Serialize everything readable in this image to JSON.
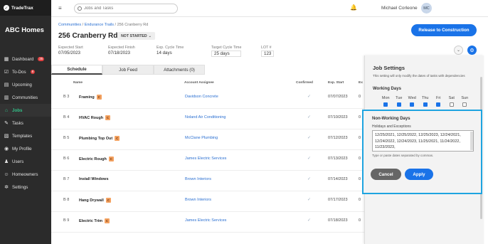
{
  "app": {
    "name": "TradeTrax",
    "company": "ABC Homes"
  },
  "sidebar": {
    "items": [
      {
        "label": "Dashboard",
        "icon": "dashboard-icon",
        "glyph": "▦",
        "badge": "35"
      },
      {
        "label": "To-Dos",
        "icon": "todo-icon",
        "glyph": "☑",
        "badge": "8"
      },
      {
        "label": "Upcoming",
        "icon": "calendar-icon",
        "glyph": "▤",
        "badge": ""
      },
      {
        "label": "Communities",
        "icon": "community-icon",
        "glyph": "▥",
        "badge": ""
      },
      {
        "label": "Jobs",
        "icon": "home-icon",
        "glyph": "⌂",
        "badge": ""
      },
      {
        "label": "Tasks",
        "icon": "wrench-icon",
        "glyph": "✎",
        "badge": ""
      },
      {
        "label": "Templates",
        "icon": "template-icon",
        "glyph": "▧",
        "badge": ""
      },
      {
        "label": "My Profile",
        "icon": "profile-icon",
        "glyph": "◉",
        "badge": ""
      },
      {
        "label": "Users",
        "icon": "users-icon",
        "glyph": "♟",
        "badge": ""
      },
      {
        "label": "Homeowners",
        "icon": "homeowners-icon",
        "glyph": "☺",
        "badge": ""
      },
      {
        "label": "Settings",
        "icon": "settings-icon",
        "glyph": "✲",
        "badge": ""
      }
    ]
  },
  "topbar": {
    "search_placeholder": "Jobs and Tasks",
    "user_name": "Michael Corleone",
    "user_initials": "MC"
  },
  "breadcrumb": {
    "a": "Communities",
    "b": "Endurance Trails",
    "current": "256 Cranberry Rd"
  },
  "job": {
    "title": "256 Cranberry Rd",
    "status": "NOT STARTED",
    "release_label": "Release to Construction",
    "meta": [
      {
        "label": "Expected Start",
        "value": "07/05/2023"
      },
      {
        "label": "Expected Finish",
        "value": "07/18/2023"
      },
      {
        "label": "Exp. Cycle Time",
        "value": "14 days"
      },
      {
        "label": "Target Cycle Time",
        "value": "25 days"
      },
      {
        "label": "LOT #",
        "value": "123"
      }
    ]
  },
  "tabs": [
    "Schedule",
    "Job Feed",
    "Attachments (0)"
  ],
  "table": {
    "headers": {
      "name": "Name",
      "assignee": "Account Assignee",
      "confirmed": "Confirmed",
      "start": "Exp. Start",
      "extra": "Ex"
    },
    "rows": [
      {
        "num": "B 3",
        "name": "Framing",
        "badge": "C",
        "assignee": "Davidson Concrete",
        "start": "07/07/2023",
        "extra": "0"
      },
      {
        "num": "B 4",
        "name": "HVAC Rough",
        "badge": "C",
        "assignee": "Noland Air Conditioning",
        "start": "07/10/2023",
        "extra": "0"
      },
      {
        "num": "B 5",
        "name": "Plumbing Top Out",
        "badge": "C",
        "assignee": "McClane Plumbing",
        "start": "07/12/2023",
        "extra": "0"
      },
      {
        "num": "B 6",
        "name": "Electric Rough",
        "badge": "C",
        "assignee": "James Electric Services",
        "start": "07/13/2023",
        "extra": "0"
      },
      {
        "num": "B 7",
        "name": "Install Windows",
        "badge": "",
        "assignee": "Brown Interiors",
        "start": "07/14/2023",
        "extra": "0"
      },
      {
        "num": "B 8",
        "name": "Hang Drywall",
        "badge": "C",
        "assignee": "Brown Interiors",
        "start": "07/17/2023",
        "extra": "0"
      },
      {
        "num": "B 9",
        "name": "Electric Trim",
        "badge": "C",
        "assignee": "James Electric Services",
        "start": "07/18/2023",
        "extra": "0"
      }
    ]
  },
  "job_settings": {
    "title": "Job Settings",
    "note": "This setting will only modify the dates of tasks with dependencies",
    "working_days_title": "Working Days",
    "days": [
      {
        "label": "Mon",
        "checked": true
      },
      {
        "label": "Tue",
        "checked": true
      },
      {
        "label": "Wed",
        "checked": true
      },
      {
        "label": "Thu",
        "checked": true
      },
      {
        "label": "Fri",
        "checked": true
      },
      {
        "label": "Sat",
        "checked": false
      },
      {
        "label": "Sun",
        "checked": false
      }
    ],
    "non_working_title": "Non-Working Days",
    "holidays_label": "Holidays and Exceptions",
    "holidays_value": "12/25/2021, 12/25/2022, 12/25/2023, 12/24/2021, 12/24/2022, 12/24/2023, 11/25/2021, 11/24/2022, 11/23/2023,",
    "hint": "Type or paste dates separated by commas.",
    "cancel_label": "Cancel",
    "apply_label": "Apply"
  },
  "colors": {
    "accent": "#1a73e8",
    "sidebar": "#2b2b2b",
    "active_nav": "#32c38a",
    "highlight": "#1ea4e0",
    "badge": "#f4a261"
  }
}
